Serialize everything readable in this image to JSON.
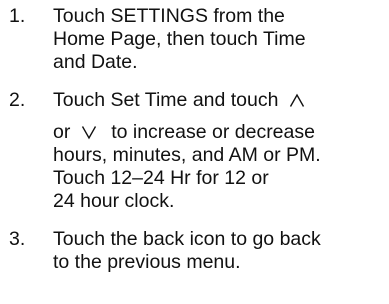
{
  "instructions": {
    "steps": [
      {
        "number": "1.",
        "lines": [
          "Touch SETTINGS from the",
          "Home Page, then touch Time",
          "and Date."
        ]
      },
      {
        "number": "2.",
        "line1_prefix": "Touch Set Time and touch",
        "line2_prefix": "or",
        "line2_suffix": "to increase or decrease",
        "lines_rest": [
          "hours, minutes, and AM or PM.",
          "Touch 12–24 Hr for 12 or",
          "24 hour clock."
        ]
      },
      {
        "number": "3.",
        "lines": [
          "Touch the back icon to go back",
          "to the previous menu."
        ]
      }
    ],
    "icons": {
      "up": "chevron-up-icon",
      "down": "chevron-down-icon"
    },
    "text_color": "#111111"
  }
}
